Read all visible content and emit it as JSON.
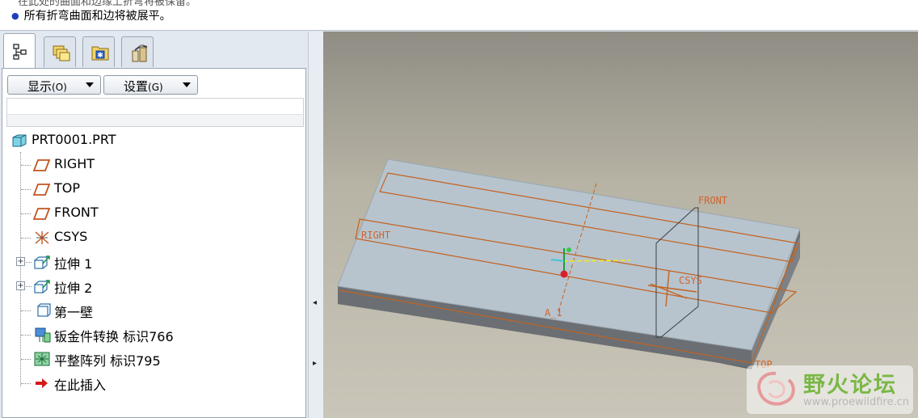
{
  "message_bar": {
    "partial_line": "在此处的曲面和边缘上折弯将被保留。",
    "message": "所有折弯曲面和边将被展平。"
  },
  "panel": {
    "tabs": [
      {
        "name": "model-tree",
        "icon": "model-tree-icon"
      },
      {
        "name": "folder-browser",
        "icon": "folder-browser-icon"
      },
      {
        "name": "favorites",
        "icon": "favorites-icon"
      },
      {
        "name": "connections",
        "icon": "connections-icon"
      }
    ],
    "show_button": {
      "label": "显示",
      "key": "(O)"
    },
    "settings_button": {
      "label": "设置",
      "key": "(G)"
    }
  },
  "tree": {
    "root": "PRT0001.PRT",
    "items": [
      {
        "label": "RIGHT",
        "icon": "datum-plane-icon"
      },
      {
        "label": "TOP",
        "icon": "datum-plane-icon"
      },
      {
        "label": "FRONT",
        "icon": "datum-plane-icon"
      },
      {
        "label": "CSYS",
        "icon": "coordinate-system-icon"
      },
      {
        "label": "拉伸 1",
        "icon": "extrude-icon",
        "expandable": true
      },
      {
        "label": "拉伸 2",
        "icon": "extrude-icon",
        "expandable": true
      },
      {
        "label": "第一壁",
        "icon": "first-wall-icon"
      },
      {
        "label": "钣金件转换 标识766",
        "icon": "sheetmetal-convert-icon"
      },
      {
        "label": "平整阵列 标识795",
        "icon": "flat-pattern-icon"
      },
      {
        "label": "在此插入",
        "icon": "insert-here-arrow-icon"
      }
    ]
  },
  "viewport": {
    "datum_labels": {
      "right": "RIGHT",
      "front": "FRONT",
      "top": "TOP",
      "csys": "CSYS",
      "axis": "A_1"
    }
  },
  "watermark": {
    "title": "野火论坛",
    "url": "www.proewildfire.cn"
  },
  "colors": {
    "datum": "#d2642a",
    "plate_top": "#b7c4ce",
    "plate_side": "#6b6f73",
    "panel_bg": "#e3e9f0"
  }
}
